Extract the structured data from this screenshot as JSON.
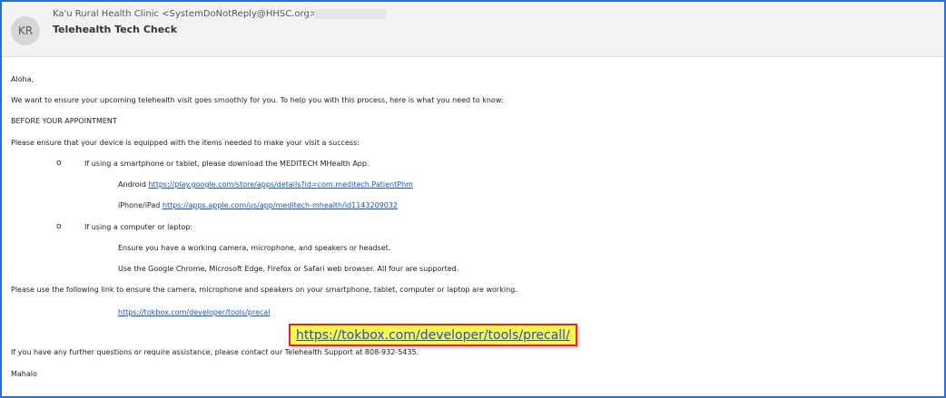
{
  "header": {
    "avatar_initials": "KR",
    "sender": "Ka'u Rural Health Clinic <SystemDoNotReply@HHSC.org>",
    "subject": "Telehealth Tech Check"
  },
  "body": {
    "greeting": "Aloha,",
    "intro": "We want to ensure your upcoming telehealth visit goes smoothly for you.  To help you with this process, here is what you need to know:",
    "section_heading": "BEFORE YOUR APPOINTMENT",
    "equip_intro": "Please ensure that your device is equipped with the items needed to make your visit a success:",
    "bullet_symbol": "o",
    "bullet_mobile": "If using a smartphone or tablet, please download the MEDITECH MHealth App.",
    "android_label": "Android",
    "android_link": "https://play.google.com/store/apps/details?id=com.meditech.PatientPhm",
    "iphone_label": "iPhone/iPad",
    "iphone_link": "https://apps.apple.com/us/app/meditech-mhealth/id1143209032",
    "bullet_computer": "If using a computer or laptop:",
    "computer_req1": "Ensure you have a working camera, microphone, and speakers or headset.",
    "computer_req2": "Use the Google Chrome, Microsoft Edge, Firefox or Safari web browser. All four are supported.",
    "precall_intro": "Please use the following link to ensure the camera, microphone and speakers on your smartphone, tablet, computer or laptop are working.",
    "precall_link_truncated": "https://tokbox.com/developer/tools/precal",
    "callout_link": "https://tokbox.com/developer/tools/precall/",
    "support": "If you have any further questions or require assistance, please contact our Telehealth Support at 808-932-5435.",
    "closing": "Mahalo"
  },
  "colors": {
    "frame_border": "#2a6fd6",
    "link": "#1a55c8",
    "callout_bg": "#fff74c",
    "callout_border": "#d72b2b"
  }
}
